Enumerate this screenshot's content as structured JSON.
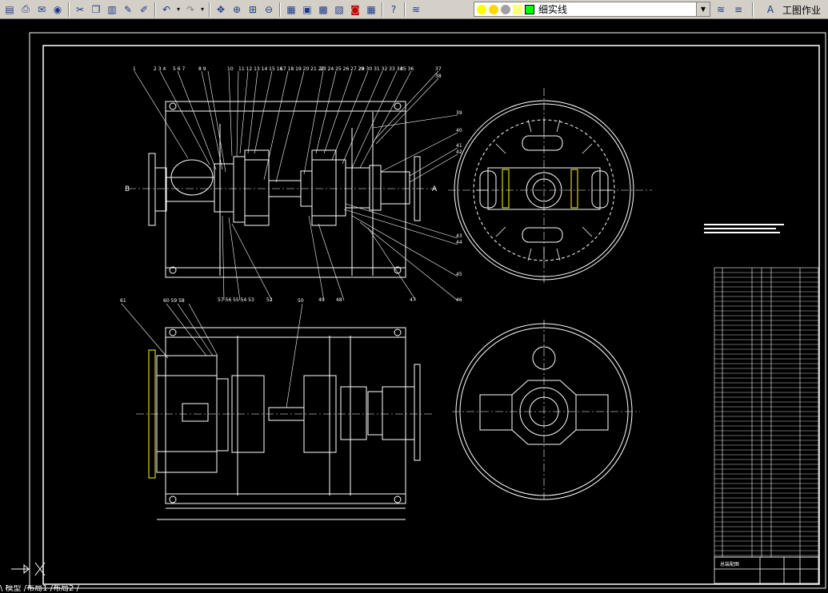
{
  "toolbar": {
    "icons": [
      "open-icon",
      "plot-preview-icon",
      "publish-icon",
      "globe-icon",
      "cut-icon",
      "copy-icon",
      "paste-icon",
      "match-properties-icon",
      "brush-icon",
      "undo-icon",
      "redo-icon",
      "pan-icon",
      "zoom-realtime-icon",
      "zoom-window-icon",
      "zoom-previous-icon",
      "properties-icon",
      "design-center-icon",
      "tool-palette-icon",
      "sheet-set-icon",
      "markup-icon",
      "calculator-icon",
      "help-icon",
      "layer-manager-icon"
    ],
    "layer_name": "细实线",
    "workspace_label": "工图作业"
  },
  "drawing": {
    "view_label_b": "B",
    "view_label_a": "A",
    "balloons_top": [
      "1",
      "2",
      "3",
      "4",
      "5",
      "6",
      "7",
      "8",
      "9",
      "10",
      "11",
      "12",
      "13",
      "14",
      "15",
      "16",
      "17",
      "18",
      "19",
      "20",
      "21",
      "22",
      "23",
      "24",
      "25",
      "26",
      "27",
      "28",
      "29",
      "30",
      "31",
      "32",
      "33",
      "34",
      "35",
      "36",
      "37"
    ],
    "balloons_right": [
      "38",
      "39",
      "40",
      "41",
      "42",
      "43",
      "44",
      "45",
      "46",
      "47"
    ],
    "balloons_bottom": [
      "52",
      "50",
      "49",
      "48"
    ],
    "balloons_lower_view": [
      "61",
      "60",
      "59",
      "58",
      "50"
    ],
    "title_block_caption": "总装配图"
  },
  "status_bar": {
    "tabs_text": "\\ 模型 /布局1 /布局2 /"
  },
  "colors": {
    "toolbar_bg": "#d4d0c8",
    "canvas_bg": "#000000",
    "line_white": "#ffffff",
    "dim_green": "#00ff00"
  }
}
